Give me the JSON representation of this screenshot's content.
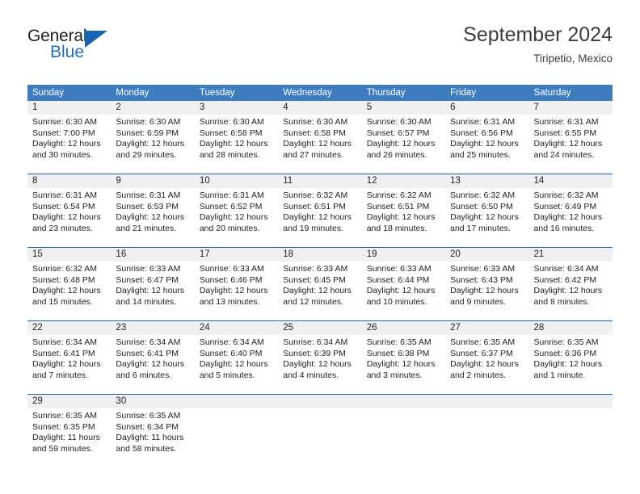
{
  "brand": {
    "name_part1": "General",
    "name_part2": "Blue",
    "accent_color": "#1565b0",
    "triangle_icon": "triangle-icon"
  },
  "header": {
    "title": "September 2024",
    "subtitle": "Tiripetio, Mexico",
    "header_bg": "#3d7dbf",
    "band_bg": "#f0f0f0"
  },
  "weekdays": [
    "Sunday",
    "Monday",
    "Tuesday",
    "Wednesday",
    "Thursday",
    "Friday",
    "Saturday"
  ],
  "weeks": [
    {
      "days": [
        {
          "num": "1",
          "sunrise": "Sunrise: 6:30 AM",
          "sunset": "Sunset: 7:00 PM",
          "daylight1": "Daylight: 12 hours",
          "daylight2": "and 30 minutes."
        },
        {
          "num": "2",
          "sunrise": "Sunrise: 6:30 AM",
          "sunset": "Sunset: 6:59 PM",
          "daylight1": "Daylight: 12 hours",
          "daylight2": "and 29 minutes."
        },
        {
          "num": "3",
          "sunrise": "Sunrise: 6:30 AM",
          "sunset": "Sunset: 6:58 PM",
          "daylight1": "Daylight: 12 hours",
          "daylight2": "and 28 minutes."
        },
        {
          "num": "4",
          "sunrise": "Sunrise: 6:30 AM",
          "sunset": "Sunset: 6:58 PM",
          "daylight1": "Daylight: 12 hours",
          "daylight2": "and 27 minutes."
        },
        {
          "num": "5",
          "sunrise": "Sunrise: 6:30 AM",
          "sunset": "Sunset: 6:57 PM",
          "daylight1": "Daylight: 12 hours",
          "daylight2": "and 26 minutes."
        },
        {
          "num": "6",
          "sunrise": "Sunrise: 6:31 AM",
          "sunset": "Sunset: 6:56 PM",
          "daylight1": "Daylight: 12 hours",
          "daylight2": "and 25 minutes."
        },
        {
          "num": "7",
          "sunrise": "Sunrise: 6:31 AM",
          "sunset": "Sunset: 6:55 PM",
          "daylight1": "Daylight: 12 hours",
          "daylight2": "and 24 minutes."
        }
      ]
    },
    {
      "days": [
        {
          "num": "8",
          "sunrise": "Sunrise: 6:31 AM",
          "sunset": "Sunset: 6:54 PM",
          "daylight1": "Daylight: 12 hours",
          "daylight2": "and 23 minutes."
        },
        {
          "num": "9",
          "sunrise": "Sunrise: 6:31 AM",
          "sunset": "Sunset: 6:53 PM",
          "daylight1": "Daylight: 12 hours",
          "daylight2": "and 21 minutes."
        },
        {
          "num": "10",
          "sunrise": "Sunrise: 6:31 AM",
          "sunset": "Sunset: 6:52 PM",
          "daylight1": "Daylight: 12 hours",
          "daylight2": "and 20 minutes."
        },
        {
          "num": "11",
          "sunrise": "Sunrise: 6:32 AM",
          "sunset": "Sunset: 6:51 PM",
          "daylight1": "Daylight: 12 hours",
          "daylight2": "and 19 minutes."
        },
        {
          "num": "12",
          "sunrise": "Sunrise: 6:32 AM",
          "sunset": "Sunset: 6:51 PM",
          "daylight1": "Daylight: 12 hours",
          "daylight2": "and 18 minutes."
        },
        {
          "num": "13",
          "sunrise": "Sunrise: 6:32 AM",
          "sunset": "Sunset: 6:50 PM",
          "daylight1": "Daylight: 12 hours",
          "daylight2": "and 17 minutes."
        },
        {
          "num": "14",
          "sunrise": "Sunrise: 6:32 AM",
          "sunset": "Sunset: 6:49 PM",
          "daylight1": "Daylight: 12 hours",
          "daylight2": "and 16 minutes."
        }
      ]
    },
    {
      "days": [
        {
          "num": "15",
          "sunrise": "Sunrise: 6:32 AM",
          "sunset": "Sunset: 6:48 PM",
          "daylight1": "Daylight: 12 hours",
          "daylight2": "and 15 minutes."
        },
        {
          "num": "16",
          "sunrise": "Sunrise: 6:33 AM",
          "sunset": "Sunset: 6:47 PM",
          "daylight1": "Daylight: 12 hours",
          "daylight2": "and 14 minutes."
        },
        {
          "num": "17",
          "sunrise": "Sunrise: 6:33 AM",
          "sunset": "Sunset: 6:46 PM",
          "daylight1": "Daylight: 12 hours",
          "daylight2": "and 13 minutes."
        },
        {
          "num": "18",
          "sunrise": "Sunrise: 6:33 AM",
          "sunset": "Sunset: 6:45 PM",
          "daylight1": "Daylight: 12 hours",
          "daylight2": "and 12 minutes."
        },
        {
          "num": "19",
          "sunrise": "Sunrise: 6:33 AM",
          "sunset": "Sunset: 6:44 PM",
          "daylight1": "Daylight: 12 hours",
          "daylight2": "and 10 minutes."
        },
        {
          "num": "20",
          "sunrise": "Sunrise: 6:33 AM",
          "sunset": "Sunset: 6:43 PM",
          "daylight1": "Daylight: 12 hours",
          "daylight2": "and 9 minutes."
        },
        {
          "num": "21",
          "sunrise": "Sunrise: 6:34 AM",
          "sunset": "Sunset: 6:42 PM",
          "daylight1": "Daylight: 12 hours",
          "daylight2": "and 8 minutes."
        }
      ]
    },
    {
      "days": [
        {
          "num": "22",
          "sunrise": "Sunrise: 6:34 AM",
          "sunset": "Sunset: 6:41 PM",
          "daylight1": "Daylight: 12 hours",
          "daylight2": "and 7 minutes."
        },
        {
          "num": "23",
          "sunrise": "Sunrise: 6:34 AM",
          "sunset": "Sunset: 6:41 PM",
          "daylight1": "Daylight: 12 hours",
          "daylight2": "and 6 minutes."
        },
        {
          "num": "24",
          "sunrise": "Sunrise: 6:34 AM",
          "sunset": "Sunset: 6:40 PM",
          "daylight1": "Daylight: 12 hours",
          "daylight2": "and 5 minutes."
        },
        {
          "num": "25",
          "sunrise": "Sunrise: 6:34 AM",
          "sunset": "Sunset: 6:39 PM",
          "daylight1": "Daylight: 12 hours",
          "daylight2": "and 4 minutes."
        },
        {
          "num": "26",
          "sunrise": "Sunrise: 6:35 AM",
          "sunset": "Sunset: 6:38 PM",
          "daylight1": "Daylight: 12 hours",
          "daylight2": "and 3 minutes."
        },
        {
          "num": "27",
          "sunrise": "Sunrise: 6:35 AM",
          "sunset": "Sunset: 6:37 PM",
          "daylight1": "Daylight: 12 hours",
          "daylight2": "and 2 minutes."
        },
        {
          "num": "28",
          "sunrise": "Sunrise: 6:35 AM",
          "sunset": "Sunset: 6:36 PM",
          "daylight1": "Daylight: 12 hours",
          "daylight2": "and 1 minute."
        }
      ]
    },
    {
      "days": [
        {
          "num": "29",
          "sunrise": "Sunrise: 6:35 AM",
          "sunset": "Sunset: 6:35 PM",
          "daylight1": "Daylight: 11 hours",
          "daylight2": "and 59 minutes."
        },
        {
          "num": "30",
          "sunrise": "Sunrise: 6:35 AM",
          "sunset": "Sunset: 6:34 PM",
          "daylight1": "Daylight: 11 hours",
          "daylight2": "and 58 minutes."
        },
        {
          "num": "",
          "sunrise": "",
          "sunset": "",
          "daylight1": "",
          "daylight2": ""
        },
        {
          "num": "",
          "sunrise": "",
          "sunset": "",
          "daylight1": "",
          "daylight2": ""
        },
        {
          "num": "",
          "sunrise": "",
          "sunset": "",
          "daylight1": "",
          "daylight2": ""
        },
        {
          "num": "",
          "sunrise": "",
          "sunset": "",
          "daylight1": "",
          "daylight2": ""
        },
        {
          "num": "",
          "sunrise": "",
          "sunset": "",
          "daylight1": "",
          "daylight2": ""
        }
      ]
    }
  ]
}
